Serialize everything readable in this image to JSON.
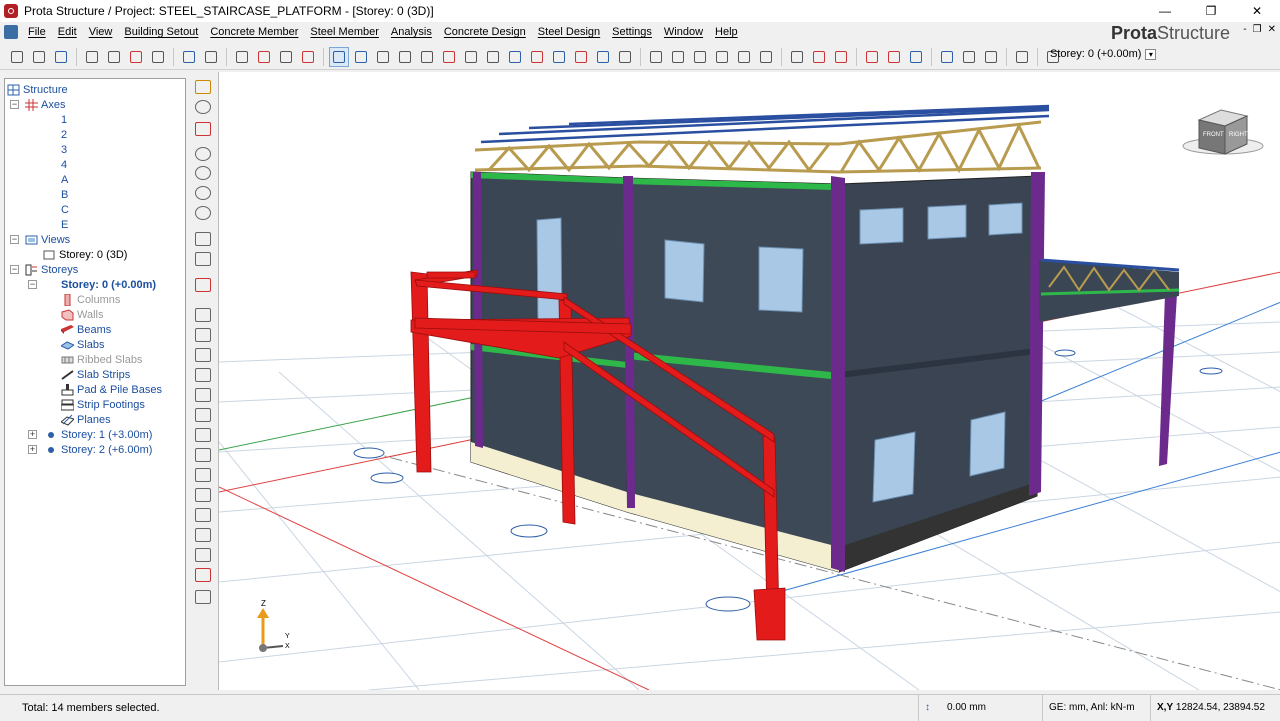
{
  "window": {
    "title": "Prota Structure / Project: STEEL_STAIRCASE_PLATFORM - [Storey: 0 (3D)]",
    "buttons": [
      "—",
      "❐",
      "✕"
    ]
  },
  "brand": {
    "prefix": "Prota",
    "suffix": "Structure"
  },
  "mdi_buttons": [
    "-",
    "❐",
    "✕"
  ],
  "menu": [
    "File",
    "Edit",
    "View",
    "Building Setout",
    "Concrete Member",
    "Steel Member",
    "Analysis",
    "Concrete Design",
    "Steel Design",
    "Settings",
    "Window",
    "Help"
  ],
  "toolbar": {
    "storey_value": "Storey: 0 (+0.00m)"
  },
  "tree": {
    "root": "Structure",
    "axes_label": "Axes",
    "axes": [
      "1",
      "2",
      "3",
      "4",
      "A",
      "B",
      "C",
      "E"
    ],
    "views_label": "Views",
    "views": [
      "Storey: 0 (3D)"
    ],
    "storeys_label": "Storeys",
    "current_storey": "Storey: 0 (+0.00m)",
    "members": [
      "Columns",
      "Walls",
      "Beams",
      "Slabs",
      "Ribbed Slabs",
      "Slab Strips",
      "Pad & Pile Bases",
      "Strip Footings",
      "Planes"
    ],
    "other_storeys": [
      "Storey: 1 (+3.00m)",
      "Storey: 2 (+6.00m)"
    ]
  },
  "viewcube": {
    "front": "FRONT",
    "right": "RIGHT"
  },
  "axis_triad": {
    "z": "Z",
    "y": "Y",
    "x": "X"
  },
  "status": {
    "selection": "Total: 14 members selected.",
    "elevation": "0.00 mm",
    "units": "GE: mm, Anl: kN-m",
    "coord_label": "X,Y",
    "coords": "12824.54, 23894.52"
  },
  "colors": {
    "red_member": "#e31b1b",
    "purple_column": "#6b2a8c",
    "green_beam": "#2fb84a",
    "wall": "#3b4654",
    "truss": "#d8bf7a",
    "roof_purlin": "#2a4fa0"
  }
}
